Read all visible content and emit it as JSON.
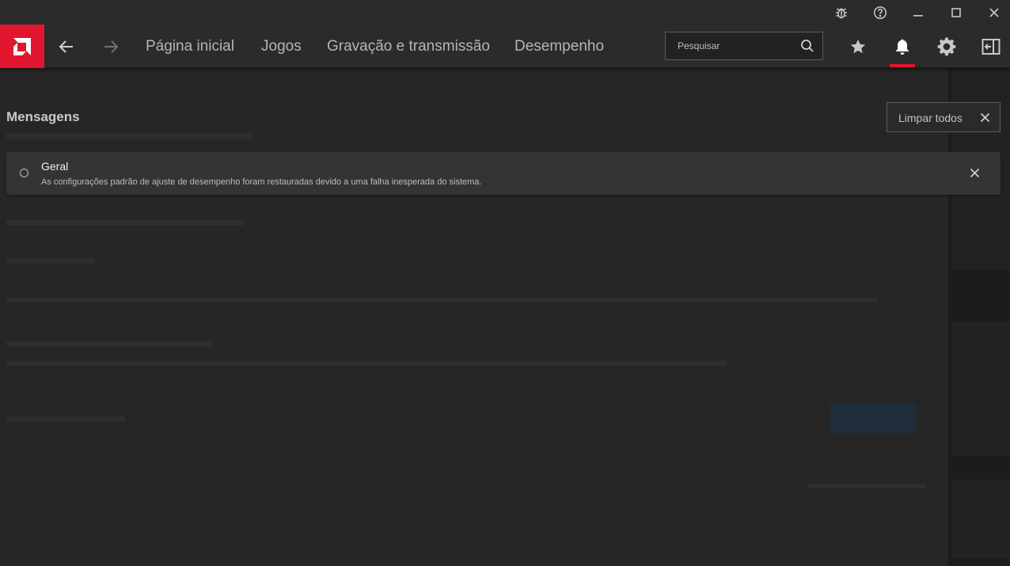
{
  "titlebar": {
    "icons": [
      "bug-icon",
      "help-icon",
      "minimize-icon",
      "maximize-icon",
      "close-icon"
    ]
  },
  "nav": {
    "links": [
      "Página inicial",
      "Jogos",
      "Gravação e transmissão",
      "Desempenho"
    ],
    "search_placeholder": "Pesquisar",
    "icons": [
      "star-icon",
      "bell-icon",
      "gear-icon",
      "sidebar-toggle-icon"
    ],
    "active_icon": "bell-icon"
  },
  "messages": {
    "title": "Mensagens",
    "clear_all_label": "Limpar todos",
    "items": [
      {
        "title": "Geral",
        "body": "As configurações padrão de ajuste de desempenho foram restauradas devido a uma falha inesperada do sistema."
      }
    ]
  },
  "colors": {
    "accent": "#e2152e",
    "chrome": "#2b2b2b",
    "card": "#343434"
  }
}
